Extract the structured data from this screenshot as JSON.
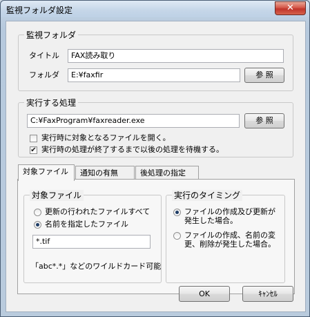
{
  "window": {
    "title": "監視フォルダ設定",
    "close_glyph": "✕"
  },
  "monitor": {
    "legend": "監視フォルダ",
    "title_label": "タイトル",
    "title_value": "FAX読み取り",
    "folder_label": "フォルダ",
    "folder_value": "E:¥faxfir",
    "browse_label": "参 照"
  },
  "process": {
    "legend": "実行する処理",
    "command_value": "C:¥FaxProgram¥faxreader.exe",
    "browse_label": "参 照",
    "open_file_label": "実行時に対象となるファイルを開く。",
    "open_file_checked": false,
    "wait_label": "実行時の処理が終了するまで以後の処理を待機する。",
    "wait_checked": true
  },
  "tabs": [
    {
      "label": "対象ファイル",
      "active": true
    },
    {
      "label": "通知の有無",
      "active": false
    },
    {
      "label": "後処理の指定",
      "active": false
    }
  ],
  "target_files": {
    "legend": "対象ファイル",
    "option_all": "更新の行われたファイルすべて",
    "option_named": "名前を指定したファイル",
    "selected": "named",
    "pattern_value": "*.tif",
    "wildcard_note": "「abc*.*」などのワイルドカード可能"
  },
  "timing": {
    "legend": "実行のタイミング",
    "option_create_update": "ファイルの作成及び更新が\n発生した場合。",
    "option_create_update_l1": "ファイルの作成及び更新が",
    "option_create_update_l2": "発生した場合。",
    "option_other_l1": "ファイルの作成、名前の変",
    "option_other_l2": "更、削除が発生した場合。",
    "selected": "create_update"
  },
  "footer": {
    "ok_label": "OK",
    "cancel_label": "ｷｬﾝｾﾙ"
  }
}
